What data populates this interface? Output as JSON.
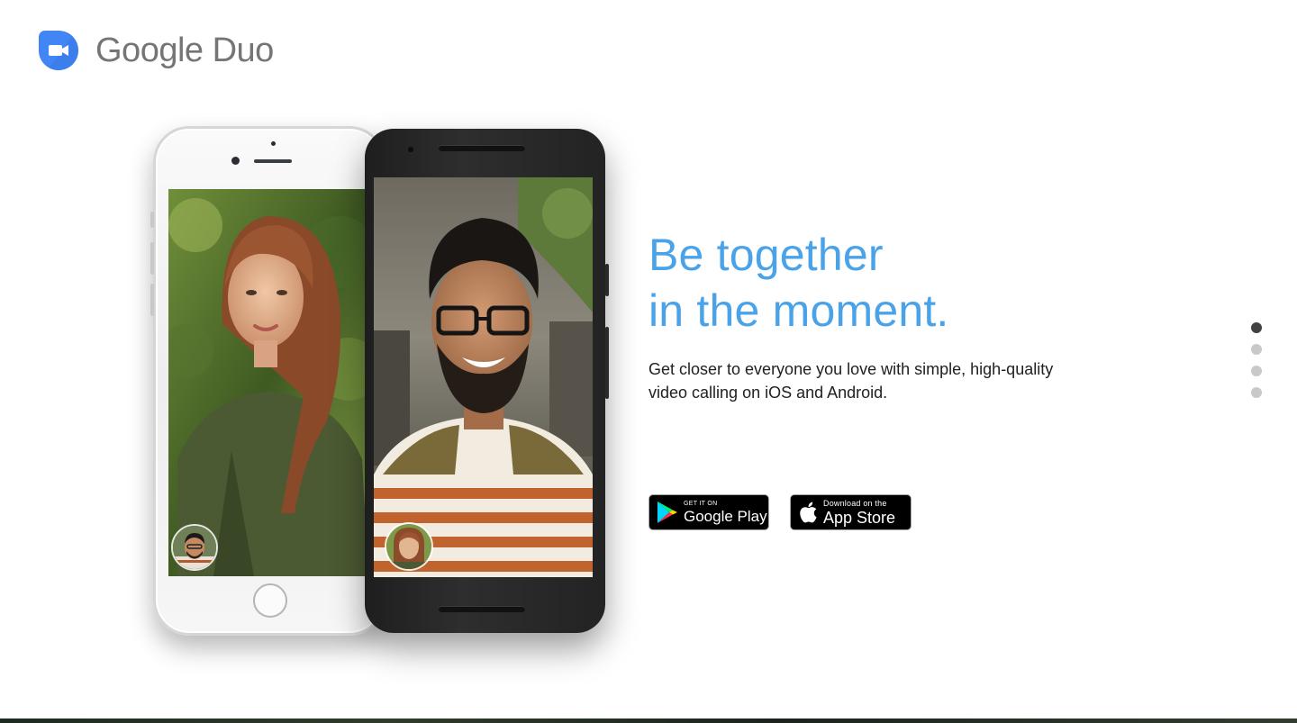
{
  "brand": {
    "name_part1": "Google",
    "name_part2": "Duo",
    "logo_icon": "duo-camera-icon",
    "logo_color": "#4285f4"
  },
  "hero": {
    "title_line1": "Be together",
    "title_line2": "in the moment.",
    "description": "Get closer to everyone you love with simple, high-quality video calling on iOS and Android.",
    "title_color": "#4aa3e8"
  },
  "store_badges": {
    "google_play": {
      "small": "GET IT ON",
      "big": "Google Play",
      "icon": "google-play-icon"
    },
    "app_store": {
      "small": "Download on the",
      "big": "App Store",
      "icon": "apple-icon"
    }
  },
  "pagination": {
    "active_index": 0,
    "slides": [
      {
        "label": "slide-1"
      },
      {
        "label": "slide-2"
      },
      {
        "label": "slide-3"
      },
      {
        "label": "slide-4"
      }
    ]
  }
}
